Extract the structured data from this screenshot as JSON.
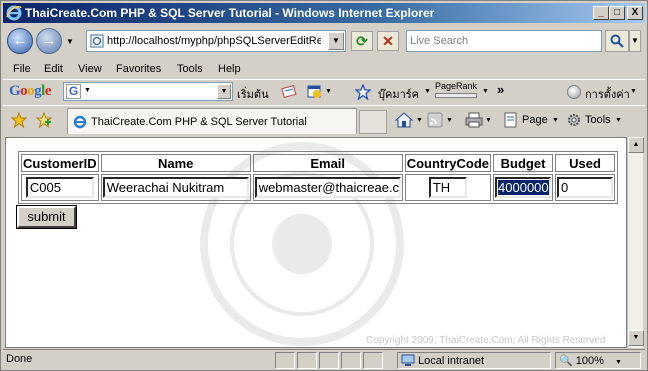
{
  "window": {
    "title": "ThaiCreate.Com PHP & SQL Server Tutorial - Windows Internet Explorer",
    "minimize": "_",
    "maximize": "□",
    "close": "X"
  },
  "address": {
    "url": "http://localhost/myphp/phpSQLServerEditRec",
    "search_placeholder": "Live Search"
  },
  "menu": [
    "File",
    "Edit",
    "View",
    "Favorites",
    "Tools",
    "Help"
  ],
  "google_toolbar": {
    "logo": "Google",
    "start_label": "เริ่มต้น",
    "bookmarks_label": "บุ๊คมาร์ค",
    "pagerank_label": "PageRank",
    "settings_label": "การตั้งค่า",
    "more": "»"
  },
  "tab": {
    "title": "ThaiCreate.Com PHP & SQL Server Tutorial"
  },
  "commands": {
    "page": "Page",
    "tools": "Tools"
  },
  "table": {
    "headers": [
      "CustomerID",
      "Name",
      "Email",
      "CountryCode",
      "Budget",
      "Used"
    ],
    "row": {
      "customer_id": "C005",
      "name": "Weerachai Nukitram",
      "email": "webmaster@thaicreae.c",
      "country_code": "TH",
      "budget": "4000000",
      "used": "0"
    }
  },
  "form": {
    "submit_label": "submit"
  },
  "footer": {
    "copyright": "Copyright 2009, ThaiCreate.Com, All Rights Reserved"
  },
  "status": {
    "text": "Done",
    "zone": "Local intranet",
    "zoom": "100%"
  },
  "colors": {
    "title_bar": "#0a246a",
    "chrome": "#d4d0c8",
    "selection": "#0a246a"
  }
}
